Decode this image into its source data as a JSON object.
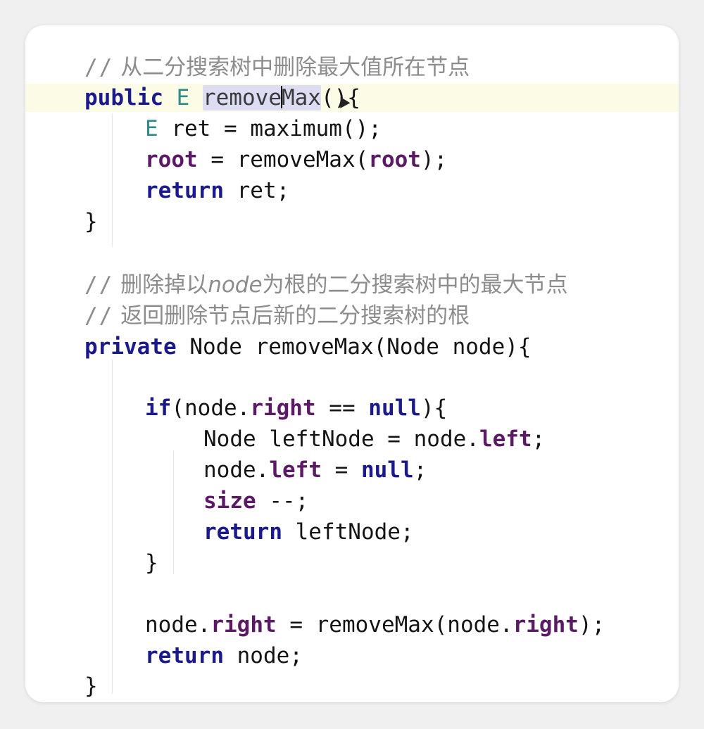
{
  "code": {
    "comment1": "从二分搜索树中删除最大值所在节点",
    "comment_prefix": "//",
    "l2_public": "public",
    "l2_type": "E",
    "l2_method_a": "remove",
    "l2_method_b": "Max",
    "l2_rest": "(){",
    "l3_type": "E",
    "l3_rest": " ret = maximum();",
    "l4_root1": "root",
    "l4_mid": " = removeMax(",
    "l4_root2": "root",
    "l4_end": ");",
    "l5_return": "return",
    "l5_rest": " ret;",
    "close_brace": "}",
    "comment2_a": "删除掉以",
    "comment2_node": "node",
    "comment2_b": "为根的二分搜索树中的最大节点",
    "comment3": "返回删除节点后新的二分搜索树的根",
    "l9_private": "private",
    "l9_rest": " Node removeMax(Node node){",
    "l11_if": "if",
    "l11_a": "(node.",
    "l11_right": "right",
    "l11_b": " == ",
    "l11_null": "null",
    "l11_c": "){",
    "l12_a": "Node leftNode = node.",
    "l12_left": "left",
    "l12_b": ";",
    "l13_a": "node.",
    "l13_left": "left",
    "l13_b": " = ",
    "l13_null": "null",
    "l13_c": ";",
    "l14_size": "size",
    "l14_rest": " --;",
    "l15_return": "return",
    "l15_rest": " leftNode;",
    "l18_a": "node.",
    "l18_right1": "right",
    "l18_b": " = removeMax(node.",
    "l18_right2": "right",
    "l18_c": ");",
    "l19_return": "return",
    "l19_rest": " node;"
  },
  "colors": {
    "keyword": "#1a1a8c",
    "field": "#5c1a66",
    "comment": "#8c8c8c",
    "type": "#2f8c8c",
    "line_highlight": "#fbfbe6",
    "selection": "#dcdcf2"
  }
}
